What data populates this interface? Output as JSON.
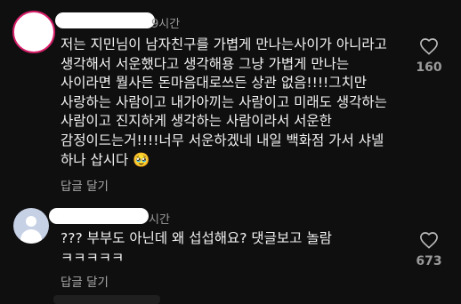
{
  "comments": [
    {
      "time": "9시간",
      "text": "저는 지민님이 남자친구를 가볍게 만나는사이가 아니라고 생각해서 서운했다고 생각해용 그냥 가볍게 만나는 사이라면 뭘사든 돈마음대로쓰든 상관 없음!!!!그치만 사랑하는 사람이고 내가아끼는 사람이고 미래도 생각하는 사람이고 진지하게 생각하는 사람이라서 서운한 감정이드는거!!!!너무 서운하겠네 내일 백화점 가서 샤넬 하나 삽시다 🥹",
      "reply_label": "답글 달기",
      "likes": "160"
    },
    {
      "time": "시간",
      "text": "??? 부부도 아닌데 왜 섭섭해요? 댓글보고 놀람 ㅋㅋㅋㅋㅋ",
      "reply_label": "답글 달기",
      "likes": "673"
    }
  ],
  "icons": {
    "like": "heart-outline-icon",
    "avatar": "default-avatar-icon"
  }
}
